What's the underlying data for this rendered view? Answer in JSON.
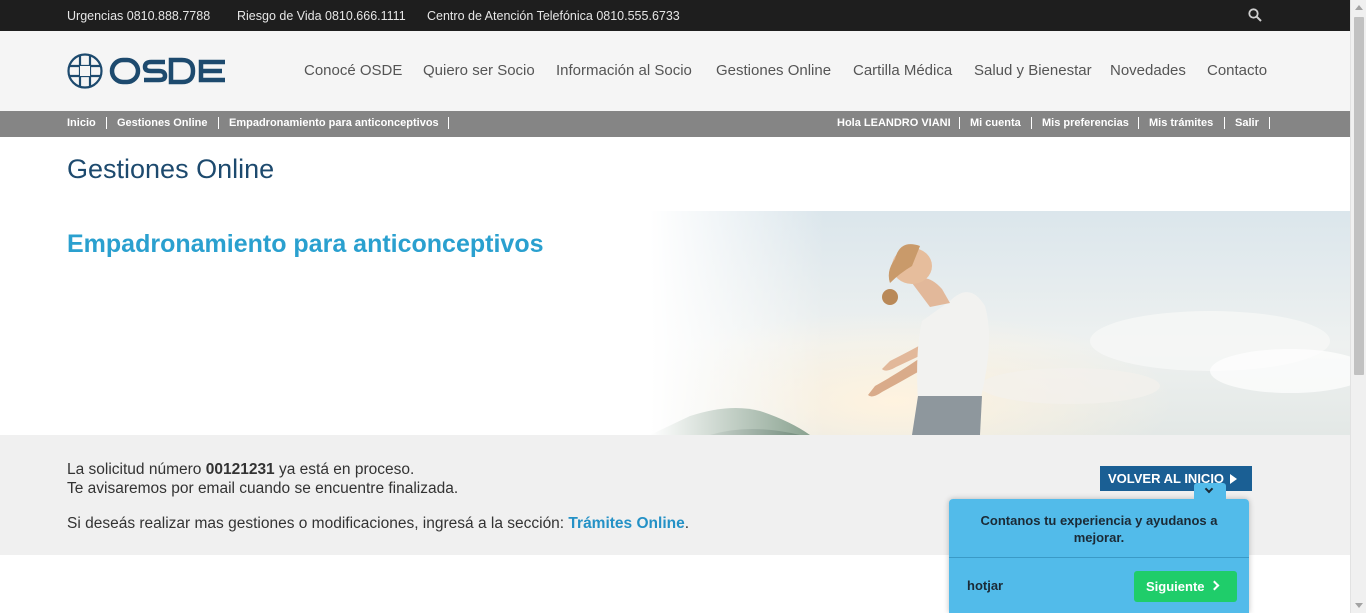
{
  "topbar": {
    "urgencias": "Urgencias 0810.888.7788",
    "riesgo": "Riesgo de Vida 0810.666.1111",
    "centro": "Centro de Atención Telefónica 0810.555.6733"
  },
  "header": {
    "logo_text": "OSDE",
    "nav": [
      "Conocé OSDE",
      "Quiero ser Socio",
      "Información al Socio",
      "Gestiones Online",
      "Cartilla Médica",
      "Salud y Bienestar",
      "Novedades",
      "Contacto"
    ]
  },
  "breadcrumb": [
    "Inicio",
    "Gestiones Online",
    "Empadronamiento para anticonceptivos"
  ],
  "user_menu": {
    "greeting": "Hola LEANDRO VIANI",
    "items": [
      "Mi cuenta",
      "Mis preferencias",
      "Mis trámites",
      "Salir"
    ]
  },
  "page_title": "Gestiones Online",
  "hero": {
    "title": "Empadronamiento para anticonceptivos"
  },
  "message": {
    "line1_pre": "La solicitud número ",
    "request_number": "00121231",
    "line1_post": " ya está en proceso.",
    "line2": "Te avisaremos por email cuando se encuentre finalizada.",
    "line3_pre": "Si deseás realizar mas gestiones o modificaciones, ingresá a la sección: ",
    "line3_link": "Trámites Online",
    "line3_post": "."
  },
  "volver_button": "VOLVER AL INICIO",
  "hotjar": {
    "prompt": "Contanos tu experiencia y ayudanos a mejorar.",
    "brand": "hotjar",
    "next": "Siguiente"
  },
  "colors": {
    "topbar": "#1e1e1e",
    "title": "#1d4a6e",
    "accent": "#2aa0cf",
    "button": "#1a5f94",
    "hotjar": "#52bbea",
    "hotjar_button": "#1fcd6a"
  }
}
